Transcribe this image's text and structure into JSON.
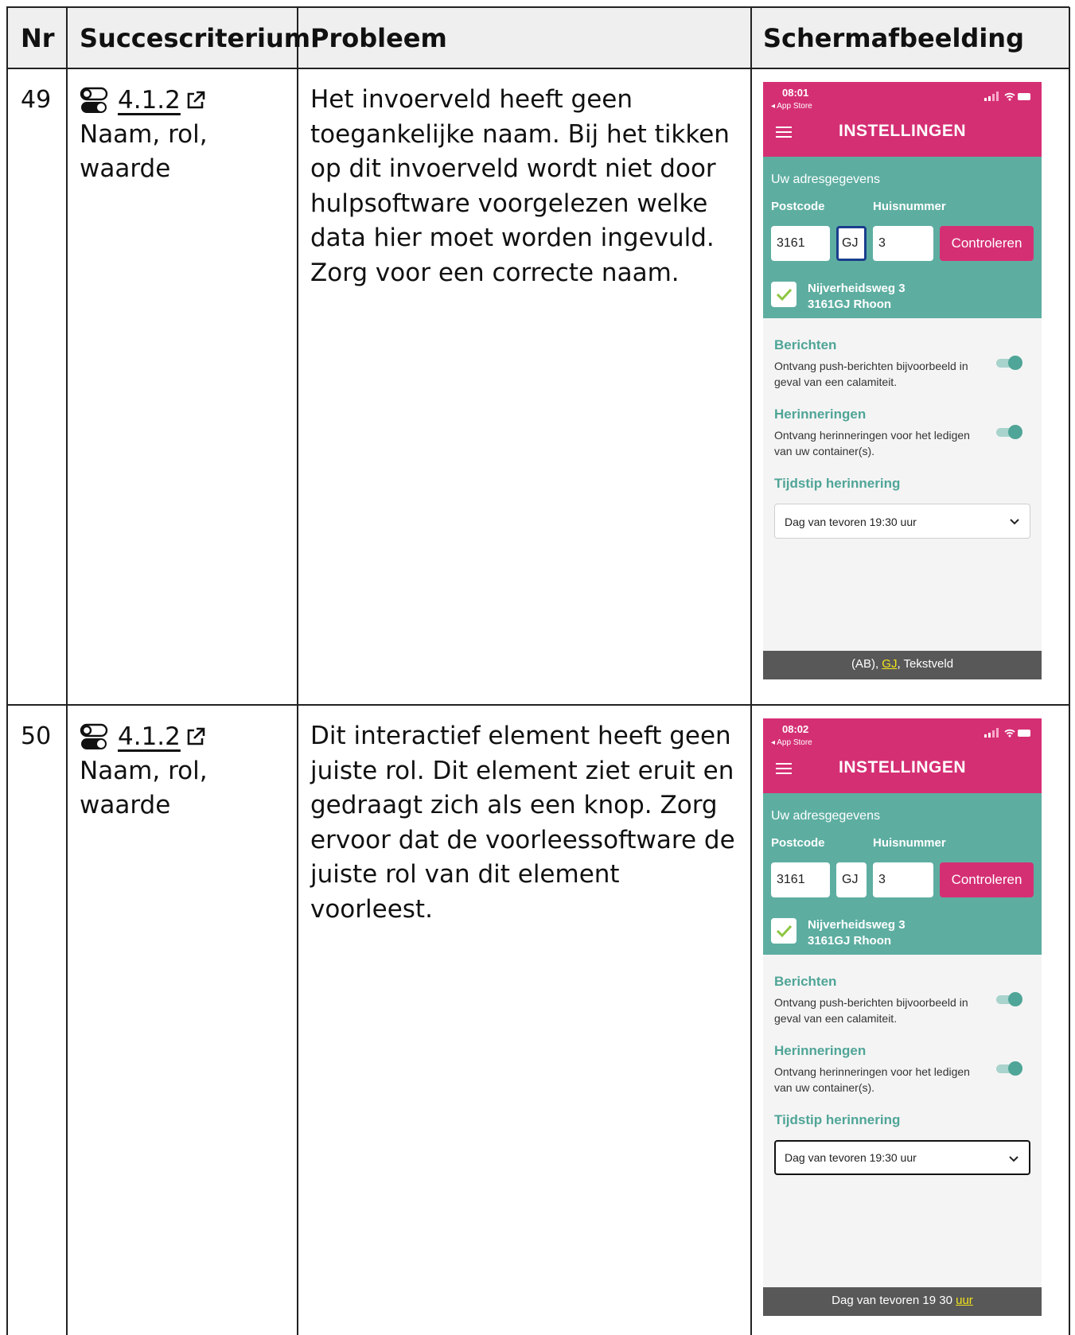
{
  "table": {
    "headers": {
      "nr": "Nr",
      "criterion": "Succescriterium",
      "problem": "Probleem",
      "screenshot": "Schermafbeelding"
    },
    "rows": [
      {
        "nr": "49",
        "criterion_code": "4.1.2",
        "criterion_name": "Naam, rol, waarde",
        "problem": "Het invoerveld heeft geen toegankelijke naam. Bij het tikken op dit invoerveld wordt niet door hulpsoftware voorgelezen welke data hier moet worden ingevuld. Zorg voor een correcte naam.",
        "phone": {
          "time": "08:01",
          "back_label": "◂ App Store",
          "title": "INSTELLINGEN",
          "address_section": "Uw adresgegevens",
          "postcode_label": "Postcode",
          "housenumber_label": "Huisnummer",
          "postcode_digits": "3161",
          "postcode_letters": "GJ",
          "housenumber": "3",
          "check_button": "Controleren",
          "address_line1": "Nijverheidsweg 3",
          "address_line2": "3161GJ Rhoon",
          "messages_heading": "Berichten",
          "messages_text": "Ontvang push-berichten bijvoorbeeld in geval van een calamiteit.",
          "reminders_heading": "Herinneringen",
          "reminders_text": "Ontvang herinneringen voor het ledigen van uw container(s).",
          "time_heading": "Tijdstip herinnering",
          "time_select": "Dag van tevoren 19:30 uur",
          "voiceover_pre": "(AB), ",
          "voiceover_hl": "GJ",
          "voiceover_post": ", Tekstveld"
        }
      },
      {
        "nr": "50",
        "criterion_code": "4.1.2",
        "criterion_name": "Naam, rol, waarde",
        "problem": "Dit interactief element heeft geen juiste rol. Dit element ziet eruit en gedraagt zich als een knop. Zorg ervoor dat de voorleessoftware de juiste rol van dit element voorleest.",
        "phone": {
          "time": "08:02",
          "back_label": "◂ App Store",
          "title": "INSTELLINGEN",
          "address_section": "Uw adresgegevens",
          "postcode_label": "Postcode",
          "housenumber_label": "Huisnummer",
          "postcode_digits": "3161",
          "postcode_letters": "GJ",
          "housenumber": "3",
          "check_button": "Controleren",
          "address_line1": "Nijverheidsweg 3",
          "address_line2": "3161GJ Rhoon",
          "messages_heading": "Berichten",
          "messages_text": "Ontvang push-berichten bijvoorbeeld in geval van een calamiteit.",
          "reminders_heading": "Herinneringen",
          "reminders_text": "Ontvang herinneringen voor het ledigen van uw container(s).",
          "time_heading": "Tijdstip herinnering",
          "time_select": "Dag van tevoren 19:30 uur",
          "voiceover_pre": "Dag van tevoren  19  30 ",
          "voiceover_hl": "uur",
          "voiceover_post": ""
        }
      }
    ]
  },
  "colors": {
    "brand_pink": "#d52f74",
    "teal": "#5daea1",
    "focus_blue": "#1a3e8c",
    "voiceover_highlight": "#f3e51b"
  },
  "icons": [
    "toggle-icon",
    "external-link-icon",
    "menu-icon",
    "checkmark-icon",
    "toggle-switch-icon",
    "chevron-down-icon"
  ]
}
